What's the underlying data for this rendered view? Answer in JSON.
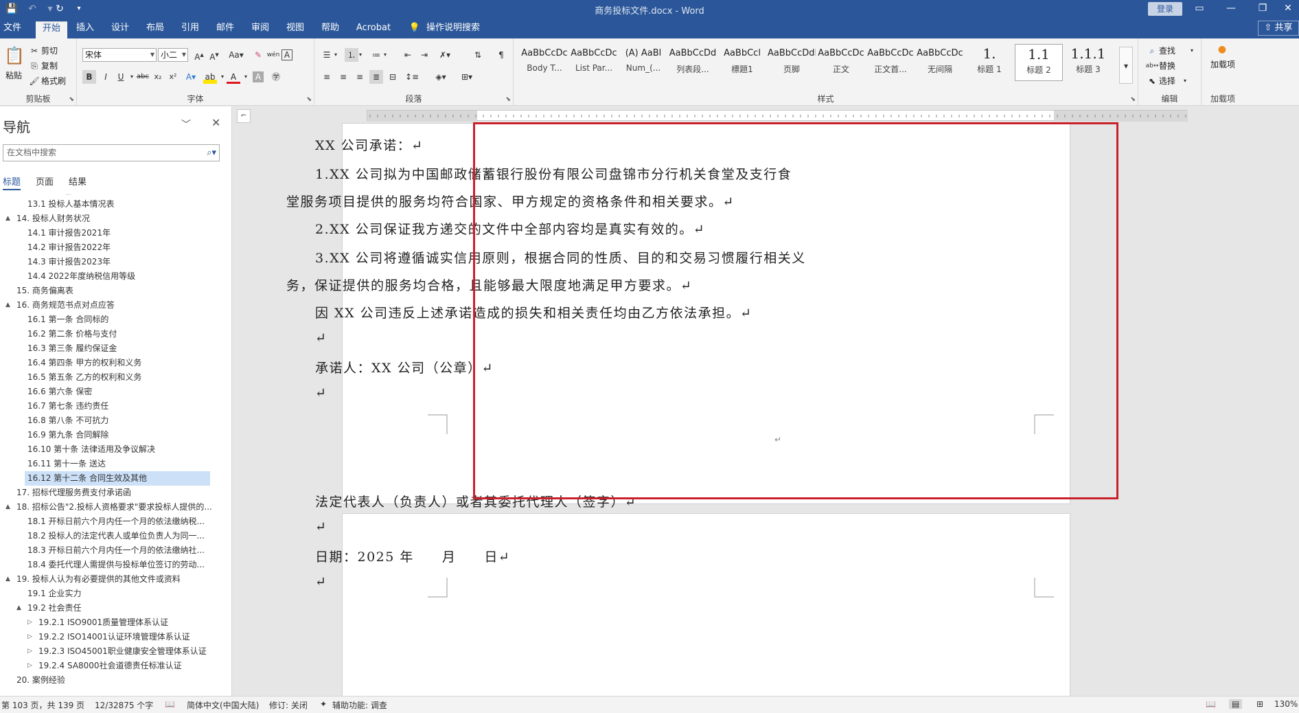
{
  "app": {
    "title": "商务投标文件.docx - Word",
    "login_label": "登录",
    "share_label": "共享"
  },
  "tabs": [
    "文件",
    "开始",
    "插入",
    "设计",
    "布局",
    "引用",
    "邮件",
    "审阅",
    "视图",
    "帮助",
    "Acrobat",
    "操作说明搜索"
  ],
  "ribbon": {
    "clipboard": {
      "paste": "粘贴",
      "cut": "剪切",
      "copy": "复制",
      "format_painter": "格式刷",
      "label": "剪贴板"
    },
    "font": {
      "name": "宋体",
      "size": "小二",
      "label": "字体"
    },
    "paragraph": {
      "label": "段落"
    },
    "styles": {
      "label": "样式",
      "items": [
        {
          "sample": "AaBbCcDc",
          "name": "Body T..."
        },
        {
          "sample": "AaBbCcDc",
          "name": "List Par..."
        },
        {
          "sample": "(A) AaBl",
          "name": "Num_(..."
        },
        {
          "sample": "AaBbCcDd",
          "name": "列表段..."
        },
        {
          "sample": "AaBbCcl",
          "name": "標題1"
        },
        {
          "sample": "AaBbCcDdE",
          "name": "页脚"
        },
        {
          "sample": "AaBbCcDc",
          "name": "正文"
        },
        {
          "sample": "AaBbCcDc",
          "name": "正文首..."
        },
        {
          "sample": "AaBbCcDc",
          "name": "无间隔"
        },
        {
          "sample": "1.",
          "name": "标题 1"
        },
        {
          "sample": "1.1",
          "name": "标题 2"
        },
        {
          "sample": "1.1.1",
          "name": "标题 3"
        }
      ]
    },
    "editing": {
      "find": "查找",
      "replace": "替换",
      "select": "选择",
      "label": "编辑"
    },
    "addins": {
      "load": "加载项",
      "label": "加载项"
    }
  },
  "nav": {
    "title": "导航",
    "search_placeholder": "在文档中搜索",
    "tabs": [
      "标题",
      "页面",
      "结果"
    ],
    "items": [
      {
        "text": "13.1 投标人基本情况表",
        "level": 2,
        "arrow": ""
      },
      {
        "text": "14. 投标人财务状况",
        "level": 1,
        "arrow": "▲"
      },
      {
        "text": "14.1 审计报告2021年",
        "level": 2,
        "arrow": ""
      },
      {
        "text": "14.2 审计报告2022年",
        "level": 2,
        "arrow": ""
      },
      {
        "text": "14.3 审计报告2023年",
        "level": 2,
        "arrow": ""
      },
      {
        "text": "14.4 2022年度纳税信用等级",
        "level": 2,
        "arrow": ""
      },
      {
        "text": "15. 商务偏离表",
        "level": 1,
        "arrow": ""
      },
      {
        "text": "16. 商务规范书点对点应答",
        "level": 1,
        "arrow": "▲"
      },
      {
        "text": "16.1 第一条 合同标的",
        "level": 2,
        "arrow": ""
      },
      {
        "text": "16.2 第二条 价格与支付",
        "level": 2,
        "arrow": ""
      },
      {
        "text": "16.3 第三条 履约保证金",
        "level": 2,
        "arrow": ""
      },
      {
        "text": "16.4 第四条 甲方的权利和义务",
        "level": 2,
        "arrow": ""
      },
      {
        "text": "16.5 第五条 乙方的权利和义务",
        "level": 2,
        "arrow": ""
      },
      {
        "text": "16.6 第六条 保密",
        "level": 2,
        "arrow": ""
      },
      {
        "text": "16.7 第七条 违约责任",
        "level": 2,
        "arrow": ""
      },
      {
        "text": "16.8 第八条 不可抗力",
        "level": 2,
        "arrow": ""
      },
      {
        "text": "16.9 第九条 合同解除",
        "level": 2,
        "arrow": ""
      },
      {
        "text": "16.10 第十条 法律适用及争议解决",
        "level": 2,
        "arrow": ""
      },
      {
        "text": "16.11 第十一条 送达",
        "level": 2,
        "arrow": ""
      },
      {
        "text": "16.12 第十二条 合同生效及其他",
        "level": 2,
        "arrow": "",
        "selected": true
      },
      {
        "text": "17. 招标代理服务费支付承诺函",
        "level": 1,
        "arrow": ""
      },
      {
        "text": "18. 招标公告\"2.投标人资格要求\"要求投标人提供的...",
        "level": 1,
        "arrow": "▲"
      },
      {
        "text": "18.1 开标日前六个月内任一个月的依法缴纳税...",
        "level": 2,
        "arrow": ""
      },
      {
        "text": "18.2 投标人的法定代表人或单位负责人为同一...",
        "level": 2,
        "arrow": ""
      },
      {
        "text": "18.3 开标日前六个月内任一个月的依法缴纳社...",
        "level": 2,
        "arrow": ""
      },
      {
        "text": "18.4 委托代理人需提供与投标单位签订的劳动...",
        "level": 2,
        "arrow": ""
      },
      {
        "text": "19. 投标人认为有必要提供的其他文件或资料",
        "level": 1,
        "arrow": "▲"
      },
      {
        "text": "19.1 企业实力",
        "level": 2,
        "arrow": ""
      },
      {
        "text": "19.2 社会责任",
        "level": 2,
        "arrow": "▲"
      },
      {
        "text": "19.2.1 ISO9001质量管理体系认证",
        "level": 3,
        "arrow": "▷"
      },
      {
        "text": "19.2.2 ISO14001认证环境管理体系认证",
        "level": 3,
        "arrow": "▷"
      },
      {
        "text": "19.2.3 ISO45001职业健康安全管理体系认证",
        "level": 3,
        "arrow": "▷"
      },
      {
        "text": "19.2.4 SA8000社会道德责任标准认证",
        "level": 3,
        "arrow": "▷"
      },
      {
        "text": "20. 案例经验",
        "level": 1,
        "arrow": ""
      }
    ]
  },
  "document": {
    "page1_lines": [
      {
        "text": "XX 公司承诺：↵",
        "indent": true
      },
      {
        "text": "1.XX 公司拟为中国邮政储蓄银行股份有限公司盘锦市分行机关食堂及支行食",
        "indent": true
      },
      {
        "text": "堂服务项目提供的服务均符合国家、甲方规定的资格条件和相关要求。↵",
        "indent": false
      },
      {
        "text": "2.XX 公司保证我方递交的文件中全部内容均是真实有效的。↵",
        "indent": true
      },
      {
        "text": "3.XX 公司将遵循诚实信用原则，根据合同的性质、目的和交易习惯履行相关义",
        "indent": true
      },
      {
        "text": "务，保证提供的服务均合格，且能够最大限度地满足甲方要求。↵",
        "indent": false
      },
      {
        "text": "因 XX 公司违反上述承诺造成的损失和相关责任均由乙方依法承担。↵",
        "indent": true
      },
      {
        "text": "↵",
        "indent": true
      },
      {
        "text": "承诺人：XX 公司（公章）↵",
        "indent": true
      },
      {
        "text": "↵",
        "indent": true
      }
    ],
    "page2_lines": [
      {
        "text": "法定代表人（负责人）或者其委托代理人（签字）↵",
        "indent": true
      },
      {
        "text": "↵",
        "indent": true
      },
      {
        "text": "日期：2025 年　　月　　日↵",
        "indent": true
      },
      {
        "text": "↵",
        "indent": true
      }
    ]
  },
  "status": {
    "page": "第 103 页，共 139 页",
    "words": "12/32875 个字",
    "language": "简体中文(中国大陆)",
    "track_changes": "修订: 关闭",
    "accessibility": "辅助功能: 调查",
    "zoom": "130%"
  },
  "colors": {
    "titlebar": "#2b579a",
    "highlight_box": "#c9202a",
    "nav_selected": "#cce0f7"
  }
}
